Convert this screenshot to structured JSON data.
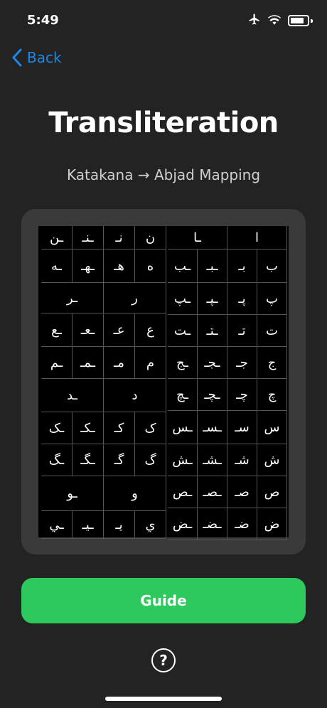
{
  "status": {
    "time": "5:49"
  },
  "nav": {
    "back_label": "Back"
  },
  "header": {
    "title": "Transliteration",
    "subtitle": "Katakana → Abjad Mapping"
  },
  "left_rows": [
    {
      "h": 32,
      "cells": [
        "ـن",
        "ـنـ",
        "نـ",
        "ن"
      ]
    },
    {
      "h": 46,
      "cells": [
        "ـه",
        "ـهـ",
        "هـ",
        "ه"
      ]
    },
    {
      "h": 42,
      "span": true,
      "cells": [
        "ـر",
        "ر"
      ]
    },
    {
      "h": 46,
      "cells": [
        "ـع",
        "ـعـ",
        "عـ",
        "ع"
      ]
    },
    {
      "h": 44,
      "cells": [
        "ـم",
        "ـمـ",
        "مـ",
        "م"
      ]
    },
    {
      "h": 46,
      "span": true,
      "cells": [
        "ـد",
        "د"
      ]
    },
    {
      "h": 44,
      "cells": [
        "ـک",
        "ـکـ",
        "کـ",
        "ک"
      ]
    },
    {
      "h": 44,
      "cells": [
        "ـگ",
        "ـگـ",
        "گـ",
        "گ"
      ]
    },
    {
      "h": 48,
      "span": true,
      "cells": [
        "ـو",
        "و"
      ]
    },
    {
      "h": 38,
      "cells": [
        "ـي",
        "ـيـ",
        "يـ",
        "ي"
      ]
    }
  ],
  "right_rows": [
    {
      "h": 32,
      "span": true,
      "cells": [
        "ـا",
        "ا"
      ]
    },
    {
      "h": 46,
      "cells": [
        "ـب",
        "ـبـ",
        "بـ",
        "ب"
      ]
    },
    {
      "h": 44,
      "cells": [
        "ـپ",
        "ـپـ",
        "پـ",
        "پ"
      ]
    },
    {
      "h": 44,
      "cells": [
        "ـت",
        "ـتـ",
        "تـ",
        "ت"
      ]
    },
    {
      "h": 44,
      "cells": [
        "ـج",
        "ـجـ",
        "جـ",
        "ج"
      ]
    },
    {
      "h": 44,
      "cells": [
        "ـچ",
        "ـچـ",
        "چـ",
        "چ"
      ]
    },
    {
      "h": 46,
      "cells": [
        "ـس",
        "ـسـ",
        "سـ",
        "س"
      ]
    },
    {
      "h": 44,
      "cells": [
        "ـش",
        "ـشـ",
        "شـ",
        "ش"
      ]
    },
    {
      "h": 44,
      "cells": [
        "ـص",
        "ـصـ",
        "صـ",
        "ص"
      ]
    },
    {
      "h": 44,
      "cells": [
        "ـض",
        "ـضـ",
        "ضـ",
        "ض"
      ]
    }
  ],
  "actions": {
    "guide_label": "Guide",
    "help_label": "?"
  }
}
